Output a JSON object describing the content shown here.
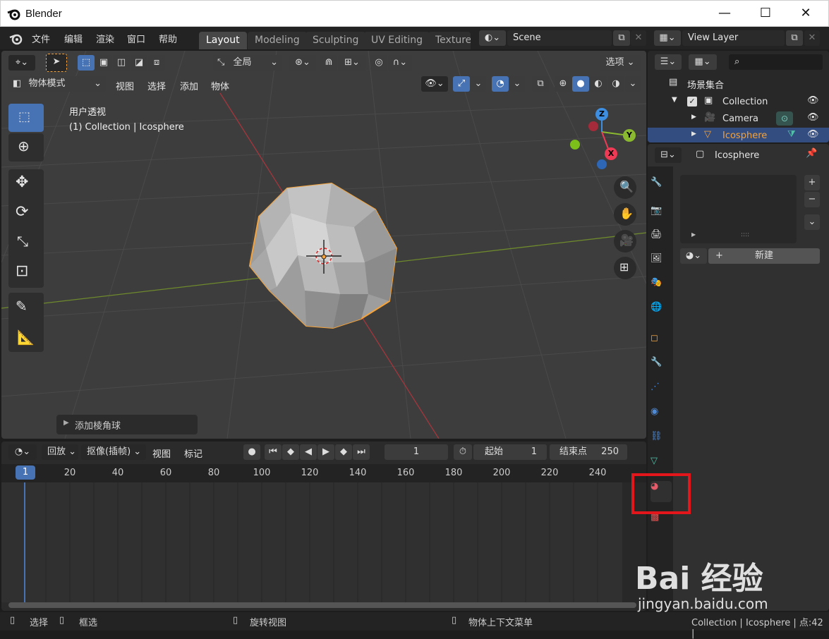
{
  "window": {
    "title": "Blender",
    "minimize": "—",
    "maximize": "☐",
    "close": "✕"
  },
  "menu": [
    "文件",
    "编辑",
    "渲染",
    "窗口",
    "帮助"
  ],
  "workspaces": [
    "Layout",
    "Modeling",
    "Sculpting",
    "UV Editing",
    "Texture"
  ],
  "scene": {
    "name": "Scene",
    "view_layer": "View Layer"
  },
  "viewport": {
    "transform_space": "全局",
    "options_label": "选项",
    "mode": "物体模式",
    "menus": [
      "视图",
      "选择",
      "添加",
      "物体"
    ],
    "overlay_title": "用户透视",
    "overlay_subtitle": "(1) Collection | Icosphere",
    "last_op": "添加棱角球",
    "gizmo": {
      "x": "X",
      "y": "Y",
      "z": "Z"
    }
  },
  "timeline": {
    "playback": "回放",
    "keying": "抠像(插帧)",
    "view": "视图",
    "marker": "标记",
    "current_frame": "1",
    "start_label": "起始",
    "start": "1",
    "end_label": "结束点",
    "end": "250",
    "ticks": [
      "20",
      "40",
      "60",
      "80",
      "100",
      "120",
      "140",
      "160",
      "180",
      "200",
      "220",
      "240"
    ],
    "playhead": "1"
  },
  "outliner": {
    "root": "场景集合",
    "items": [
      {
        "label": "Collection"
      },
      {
        "label": "Camera"
      },
      {
        "label": "Icosphere"
      }
    ]
  },
  "properties": {
    "object_name": "Icosphere",
    "new_button": "新建",
    "slot_dots": "::::"
  },
  "status": {
    "select": "选择",
    "box_select": "框选",
    "rotate_view": "旋转视图",
    "context_menu": "物体上下文菜单",
    "stats": "Collection | Icosphere | 点:42 |"
  },
  "watermark": {
    "text": "Bai 经验",
    "url": "jingyan.baidu.com"
  },
  "colors": {
    "accent": "#4772b3",
    "selection": "#f5a33a",
    "highlight": "#e3171b"
  }
}
